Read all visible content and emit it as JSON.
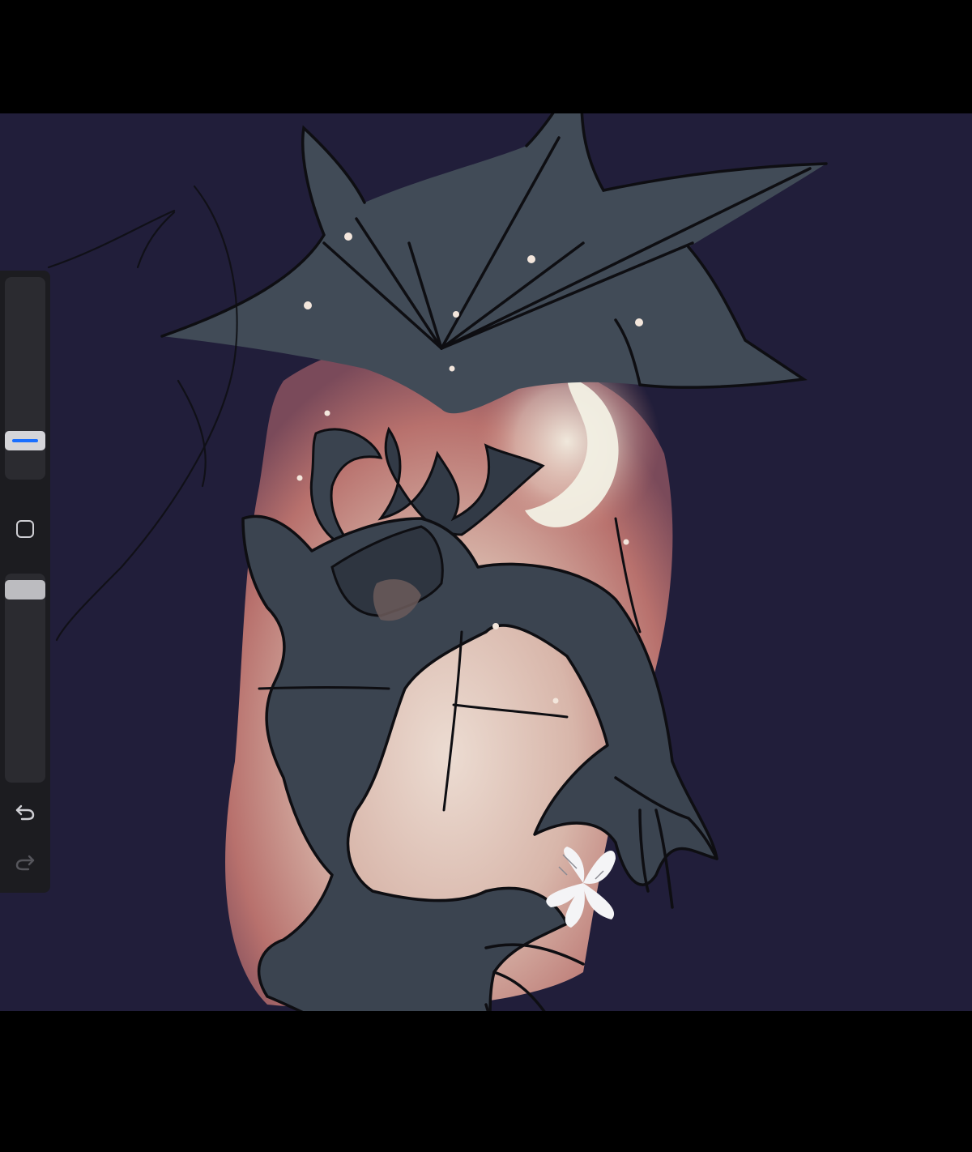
{
  "app": {
    "colors": {
      "frame": "#000000",
      "canvas_background": "#211e3a",
      "sidebar_background": "#1c1c20",
      "slider_track": "#2b2b30",
      "size_thumb": "#d4d4d8",
      "size_thumb_accent": "#1a6fff",
      "opacity_thumb": "#bcbcc0",
      "icon_active": "#cfcfd4",
      "icon_disabled": "#55555b"
    }
  },
  "sidebar": {
    "brush_size_slider": {
      "icon": "slider-thumb"
    },
    "modify_button": {
      "icon": "square-icon"
    },
    "brush_opacity_slider": {
      "icon": "slider-thumb"
    },
    "undo_button": {
      "icon": "undo-arrow-icon",
      "enabled": true
    },
    "redo_button": {
      "icon": "redo-arrow-icon",
      "enabled": false
    }
  },
  "artwork": {
    "subject": "sketch-illustration",
    "palette": {
      "night_sky": "#211e3a",
      "silhouette": "#414b57",
      "silhouette_dark": "#323a46",
      "glow_warm": "#c47a72",
      "glow_light": "#ecdcd2",
      "moon": "#f2f0e4",
      "line": "#0e0e12",
      "flower": "#f4f4f6",
      "sparkle": "#f3e6dc"
    }
  }
}
